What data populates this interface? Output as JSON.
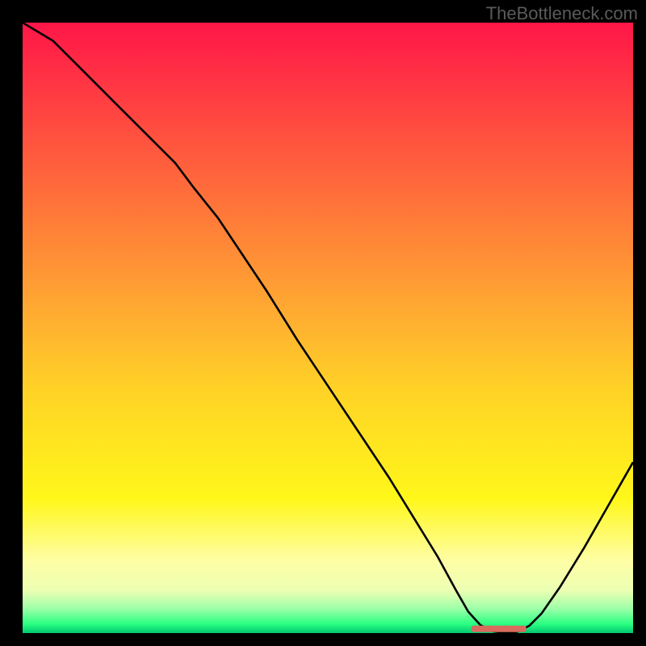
{
  "watermark": "TheBottleneck.com",
  "chart_data": {
    "type": "line",
    "title": "",
    "xlabel": "",
    "ylabel": "",
    "xlim": [
      0,
      100
    ],
    "ylim": [
      0,
      100
    ],
    "legend": null,
    "annotations": [],
    "axis_ticks_x": [],
    "axis_ticks_y": [],
    "grid": false,
    "background_gradient": {
      "stops": [
        {
          "offset": 0.0,
          "color": "#ff1648"
        },
        {
          "offset": 0.5,
          "color": "#ffb330"
        },
        {
          "offset": 0.6,
          "color": "#ffd226"
        },
        {
          "offset": 0.78,
          "color": "#fff71a"
        },
        {
          "offset": 0.88,
          "color": "#fffea4"
        },
        {
          "offset": 0.93,
          "color": "#ecffb3"
        },
        {
          "offset": 0.96,
          "color": "#9dffa8"
        },
        {
          "offset": 0.985,
          "color": "#2aff82"
        },
        {
          "offset": 1.0,
          "color": "#00c86f"
        }
      ]
    },
    "x": [
      0,
      5,
      10,
      15,
      20,
      25,
      28,
      32,
      36,
      40,
      45,
      50,
      55,
      60,
      64,
      68,
      71,
      73,
      75,
      77,
      79,
      81,
      83,
      85,
      88,
      92,
      96,
      100
    ],
    "series": [
      {
        "name": "bottleneck-curve",
        "color": "#000000",
        "values": [
          100,
          97,
          92,
          87,
          82,
          77,
          73,
          68,
          62,
          56,
          48,
          40.5,
          33,
          25.5,
          19,
          12.5,
          7,
          3.5,
          1.3,
          0.3,
          0.0,
          0.2,
          1.2,
          3.2,
          7.5,
          14,
          21,
          28
        ]
      }
    ],
    "marker": {
      "name": "optimal-range",
      "start_x": 73.5,
      "end_x": 82.5,
      "y": 0.7,
      "color": "#d86b5d"
    }
  }
}
